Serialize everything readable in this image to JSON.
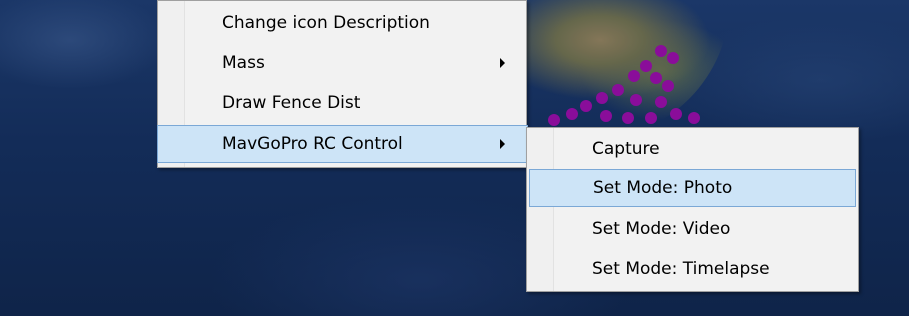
{
  "context_menu": {
    "items": [
      {
        "label": "Change icon Description",
        "has_submenu": false
      },
      {
        "label": "Mass",
        "has_submenu": true
      },
      {
        "label": "Draw Fence Dist",
        "has_submenu": false
      },
      {
        "label": "MavGoPro RC Control",
        "has_submenu": true,
        "highlighted": true
      }
    ]
  },
  "submenu": {
    "items": [
      {
        "label": "Capture"
      },
      {
        "label": "Set Mode: Photo",
        "highlighted": true
      },
      {
        "label": "Set Mode: Video"
      },
      {
        "label": "Set Mode: Timelapse"
      }
    ]
  },
  "map": {
    "marker_color": "#8a0d9a",
    "water_color": "#132c58"
  }
}
